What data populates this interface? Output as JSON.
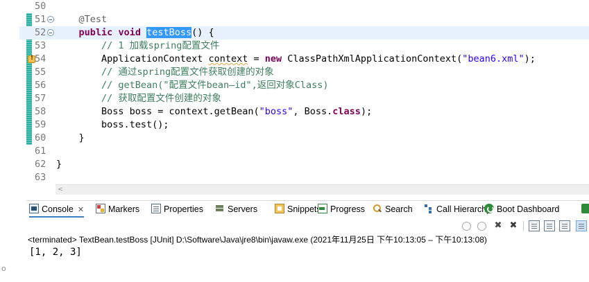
{
  "left_strip_fragment": "o",
  "editor": {
    "lines": [
      {
        "num": "50",
        "segments": []
      },
      {
        "num": "51",
        "fold": true,
        "segments": [
          {
            "t": "    "
          },
          {
            "t": "@Test",
            "c": "ann"
          }
        ]
      },
      {
        "num": "52",
        "fold": true,
        "current": true,
        "segments": [
          {
            "t": "    "
          },
          {
            "t": "public",
            "c": "kw"
          },
          {
            "t": " "
          },
          {
            "t": "void",
            "c": "kw"
          },
          {
            "t": " "
          },
          {
            "t": "testBoss",
            "c": "sel"
          },
          {
            "t": "() {"
          }
        ]
      },
      {
        "num": "53",
        "segments": [
          {
            "t": "        "
          },
          {
            "t": "// 1 加载spring配置文件",
            "c": "cm"
          }
        ]
      },
      {
        "num": "54",
        "warning": true,
        "segments": [
          {
            "t": "        ApplicationContext "
          },
          {
            "t": "context",
            "c": "warnvar"
          },
          {
            "t": " = "
          },
          {
            "t": "new",
            "c": "kw"
          },
          {
            "t": " ClassPathXmlApplicationContext("
          },
          {
            "t": "\"bean6.xml\"",
            "c": "str"
          },
          {
            "t": ");"
          }
        ]
      },
      {
        "num": "55",
        "segments": [
          {
            "t": "        "
          },
          {
            "t": "// 通过spring配置文件获取创建的对象",
            "c": "cm"
          }
        ]
      },
      {
        "num": "56",
        "segments": [
          {
            "t": "        "
          },
          {
            "t": "// getBean(\"配置文件bean—id\",返回对象Class)",
            "c": "cm"
          }
        ]
      },
      {
        "num": "57",
        "segments": [
          {
            "t": "        "
          },
          {
            "t": "// 获取配置文件创建的对象",
            "c": "cm"
          }
        ]
      },
      {
        "num": "58",
        "segments": [
          {
            "t": "        Boss boss = context.getBean("
          },
          {
            "t": "\"boss\"",
            "c": "str"
          },
          {
            "t": ", Boss."
          },
          {
            "t": "class",
            "c": "kw"
          },
          {
            "t": ");"
          }
        ]
      },
      {
        "num": "59",
        "segments": [
          {
            "t": "        boss.test();"
          }
        ]
      },
      {
        "num": "60",
        "segments": [
          {
            "t": "    }"
          }
        ]
      },
      {
        "num": "61",
        "segments": []
      },
      {
        "num": "62",
        "segments": [
          {
            "t": "}"
          }
        ]
      },
      {
        "num": "63",
        "segments": []
      }
    ]
  },
  "scrollbar": {
    "left_arrow": "<"
  },
  "panel": {
    "tabs": [
      {
        "label": "Console",
        "icon": "console-icon",
        "active": true,
        "close": "✕"
      },
      {
        "label": "Markers",
        "icon": "markers-icon"
      },
      {
        "label": "Properties",
        "icon": "properties-icon"
      },
      {
        "label": "Servers",
        "icon": "servers-icon"
      },
      {
        "label": "Snippets",
        "icon": "snippets-icon"
      },
      {
        "label": "Progress",
        "icon": "progress-icon"
      },
      {
        "label": "Search",
        "icon": "search-icon"
      },
      {
        "label": "Call Hierarchy",
        "icon": "call-hierarchy-icon"
      },
      {
        "label": "Boot Dashboard",
        "icon": "boot-dashboard-icon"
      }
    ],
    "toolbar": [
      {
        "name": "clear-console-icon"
      },
      {
        "name": "scroll-lock-icon"
      },
      {
        "name": "terminate-icon",
        "glyph": "✖"
      },
      {
        "name": "remove-all-terminated-icon",
        "glyph": "✖"
      },
      {
        "name": "word-wrap-icon"
      },
      {
        "name": "pin-console-icon"
      },
      {
        "name": "display-selected-console-icon"
      },
      {
        "name": "open-console-icon"
      }
    ],
    "status": "<terminated> TextBean.testBoss [JUnit] D:\\Software\\Java\\jre8\\bin\\javaw.exe  (2021年11月25日 下午10:13:05 – 下午10:13:08)",
    "output": "[1, 2, 3]"
  },
  "colors": {
    "keyword": "#7f0055",
    "comment": "#3f7f5f",
    "string": "#2a00ff",
    "annotation": "#646464",
    "selection": "#3399ff",
    "current_line": "#e8f2fe",
    "change_bar": "#2ab0a0"
  }
}
